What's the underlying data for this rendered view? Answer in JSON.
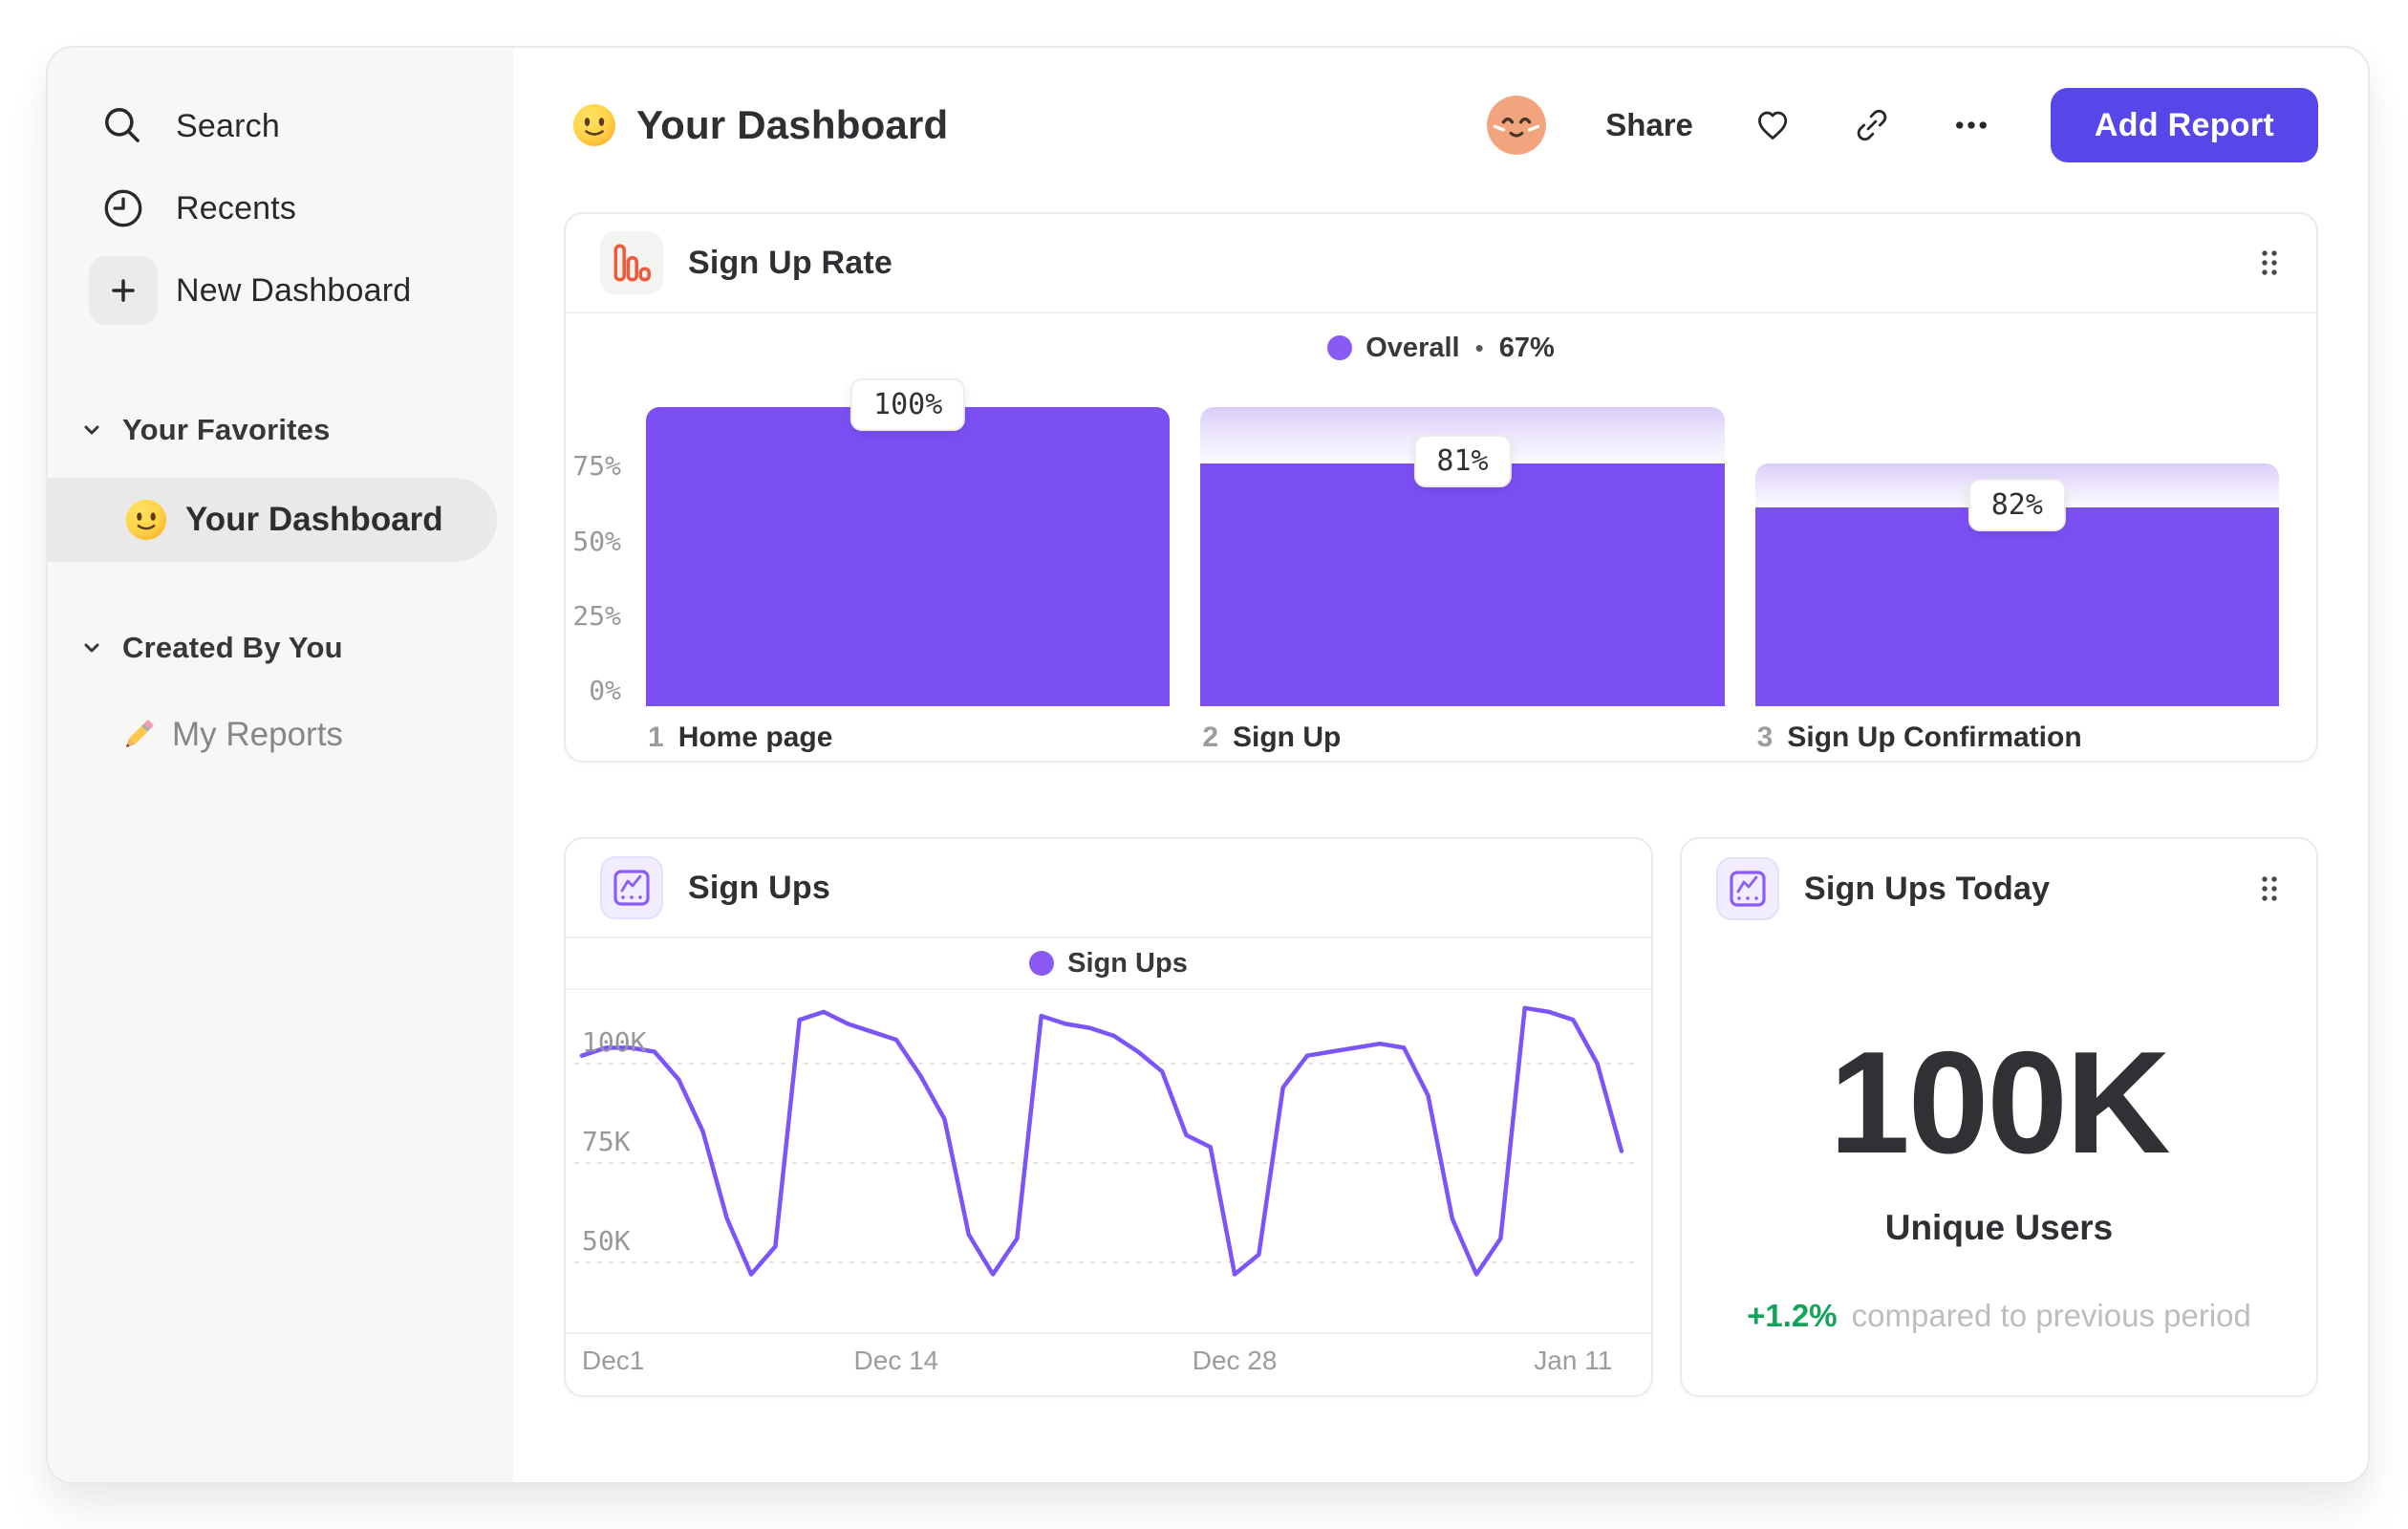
{
  "sidebar": {
    "nav": [
      {
        "label": "Search",
        "icon": "search-icon"
      },
      {
        "label": "Recents",
        "icon": "clock-icon"
      },
      {
        "label": "New Dashboard",
        "icon": "plus-icon"
      }
    ],
    "sections": [
      {
        "label": "Your Favorites"
      },
      {
        "label": "Created By You"
      }
    ],
    "favorite_item": {
      "label": "Your Dashboard",
      "icon": "smiley-emoji"
    },
    "created_item": {
      "label": "My Reports",
      "icon": "pencil-emoji"
    }
  },
  "header": {
    "title": "Your Dashboard",
    "share_label": "Share",
    "add_report_label": "Add Report"
  },
  "cards": {
    "funnel": {
      "title": "Sign Up Rate"
    },
    "line": {
      "title": "Sign Ups"
    },
    "stat": {
      "title": "Sign Ups Today"
    }
  },
  "chart_data": [
    {
      "type": "bar",
      "subtype": "funnel",
      "title": "Sign Up Rate",
      "legend_label": "Overall",
      "legend_sep": "•",
      "overall_conversion": "67%",
      "ylim": [
        0,
        100
      ],
      "y_ticks": [
        {
          "label": "75%",
          "value": 75
        },
        {
          "label": "50%",
          "value": 50
        },
        {
          "label": "25%",
          "value": 25
        },
        {
          "label": "0%",
          "value": 0
        }
      ],
      "steps": [
        {
          "num": "1",
          "label": "Home page",
          "rate_label": "100%",
          "cumulative_pct": 100,
          "prev_pct": 100
        },
        {
          "num": "2",
          "label": "Sign Up",
          "rate_label": "81%",
          "cumulative_pct": 81,
          "prev_pct": 100
        },
        {
          "num": "3",
          "label": "Sign Up Confirmation",
          "rate_label": "82%",
          "cumulative_pct": 66.4,
          "prev_pct": 81
        }
      ]
    },
    {
      "type": "line",
      "title": "Sign Ups",
      "legend_label": "Sign Ups",
      "unit": "K",
      "ylim": [
        32,
        118
      ],
      "grid": "dashed-horizontal",
      "y_ticks": [
        {
          "label": "100K",
          "value": 100
        },
        {
          "label": "75K",
          "value": 75
        },
        {
          "label": "50K",
          "value": 50
        }
      ],
      "x_ticks": [
        {
          "label": "Dec1",
          "day": 0
        },
        {
          "label": "Dec 14",
          "day": 13
        },
        {
          "label": "Dec 28",
          "day": 27
        },
        {
          "label": "Jan 11",
          "day": 41
        }
      ],
      "values": [
        102,
        104,
        104,
        103,
        96,
        83,
        61,
        47,
        54,
        111,
        113,
        110,
        108,
        106,
        97,
        86,
        57,
        47,
        56,
        112,
        110,
        109,
        107,
        103,
        98,
        82,
        79,
        47,
        52,
        94,
        102,
        103,
        104,
        105,
        104,
        92,
        61,
        47,
        56,
        114,
        113,
        111,
        100,
        78
      ]
    },
    {
      "type": "stat",
      "title": "Sign Ups Today",
      "value": "100K",
      "unit_label": "Unique Users",
      "delta": "+1.2%",
      "delta_caption": "compared to previous period"
    }
  ],
  "colors": {
    "bar_purple": "#7c4ff3",
    "bar_gradient_top": "#d9cdf9",
    "line_purple": "#7b55f7",
    "legend_dot_purple": "#8a5bf4",
    "button_purple": "#5847e8",
    "funnel_icon_orange": "#f15a38",
    "chart_icon_purple": "#8b5cf6",
    "delta_green": "#13a35b",
    "avatar_salmon": "#f2a47e",
    "sidebar_bg": "#f7f7f5"
  }
}
